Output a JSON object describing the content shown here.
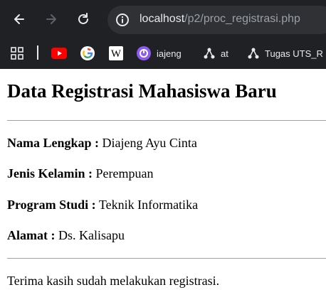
{
  "browser": {
    "url_host": "localhost",
    "url_path": "/p2/proc_registrasi.php",
    "bookmarks": [
      {
        "icon": "youtube-icon",
        "label": ""
      },
      {
        "icon": "google-icon",
        "label": ""
      },
      {
        "icon": "wikipedia-icon",
        "label": ""
      },
      {
        "icon": "app-icon",
        "label": "iajeng"
      },
      {
        "icon": "network-icon",
        "label": "at"
      },
      {
        "icon": "network-icon",
        "label": "Tugas UTS_R"
      }
    ]
  },
  "page": {
    "title": "Data Registrasi Mahasiswa Baru",
    "fields": [
      {
        "label": "Nama Lengkap :",
        "value": "Diajeng Ayu Cinta"
      },
      {
        "label": "Jenis Kelamin :",
        "value": "Perempuan"
      },
      {
        "label": "Program Studi :",
        "value": "Teknik Informatika"
      },
      {
        "label": "Alamat :",
        "value": "Ds. Kalisapu"
      }
    ],
    "thanks": "Terima kasih sudah melakukan registrasi."
  }
}
